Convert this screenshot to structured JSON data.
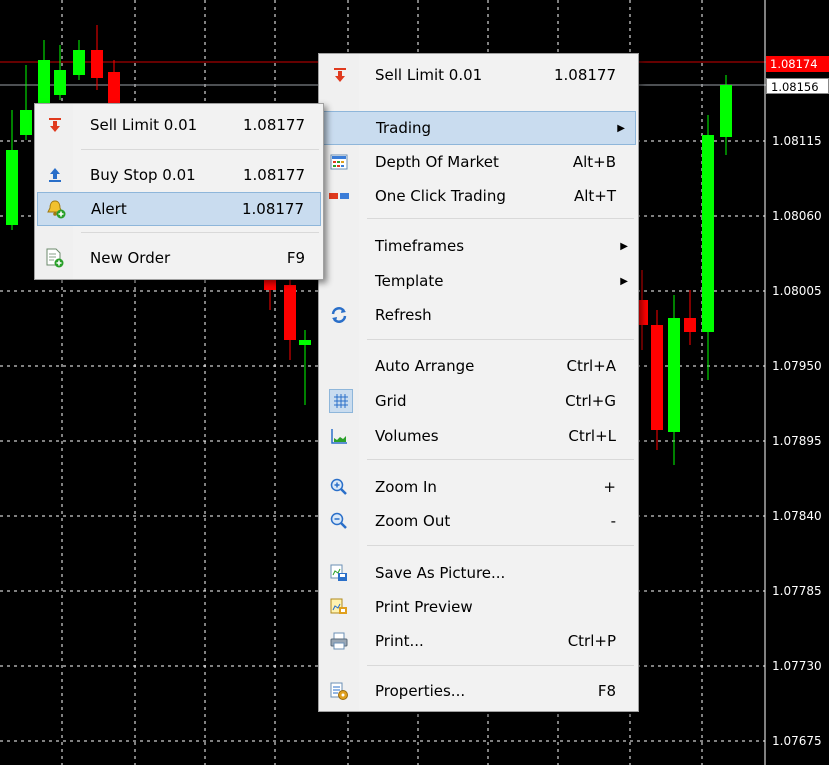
{
  "chart": {
    "price_levels": [
      "1.08115",
      "1.08060",
      "1.08005",
      "1.07950",
      "1.07895",
      "1.07840",
      "1.07785",
      "1.07730",
      "1.07675"
    ],
    "bid_tag": "1.08174",
    "ask_tag": "1.08156",
    "colors": {
      "bull": "#00ff00",
      "bear": "#ff0000",
      "grid": "#ffffff",
      "background": "#000000"
    }
  },
  "main_menu": {
    "items": [
      {
        "label": "Sell Limit 0.01",
        "shortcut": "1.08177",
        "icon": "sell-limit-icon"
      },
      {
        "label": "Trading",
        "shortcut": "",
        "icon": "",
        "submenu": true
      },
      {
        "label": "Depth Of Market",
        "shortcut": "Alt+B",
        "icon": "depth-of-market-icon"
      },
      {
        "label": "One Click Trading",
        "shortcut": "Alt+T",
        "icon": "one-click-trading-icon"
      },
      {
        "label": "Timeframes",
        "shortcut": "",
        "icon": "",
        "submenu": true
      },
      {
        "label": "Template",
        "shortcut": "",
        "icon": "",
        "submenu": true
      },
      {
        "label": "Refresh",
        "shortcut": "",
        "icon": "refresh-icon"
      },
      {
        "label": "Auto Arrange",
        "shortcut": "Ctrl+A",
        "icon": ""
      },
      {
        "label": "Grid",
        "shortcut": "Ctrl+G",
        "icon": "grid-icon"
      },
      {
        "label": "Volumes",
        "shortcut": "Ctrl+L",
        "icon": "volumes-icon"
      },
      {
        "label": "Zoom In",
        "shortcut": "+",
        "icon": "zoom-in-icon"
      },
      {
        "label": "Zoom Out",
        "shortcut": "-",
        "icon": "zoom-out-icon"
      },
      {
        "label": "Save As Picture...",
        "shortcut": "",
        "icon": "save-picture-icon"
      },
      {
        "label": "Print Preview",
        "shortcut": "",
        "icon": "print-preview-icon"
      },
      {
        "label": "Print...",
        "shortcut": "Ctrl+P",
        "icon": "print-icon"
      },
      {
        "label": "Properties...",
        "shortcut": "F8",
        "icon": "properties-icon"
      }
    ]
  },
  "sub_menu": {
    "items": [
      {
        "label": "Sell Limit 0.01",
        "shortcut": "1.08177",
        "icon": "sell-limit-icon"
      },
      {
        "label": "Buy Stop 0.01",
        "shortcut": "1.08177",
        "icon": "buy-stop-icon"
      },
      {
        "label": "Alert",
        "shortcut": "1.08177",
        "icon": "alert-bell-icon"
      },
      {
        "label": "New Order",
        "shortcut": "F9",
        "icon": "new-order-icon"
      }
    ]
  }
}
